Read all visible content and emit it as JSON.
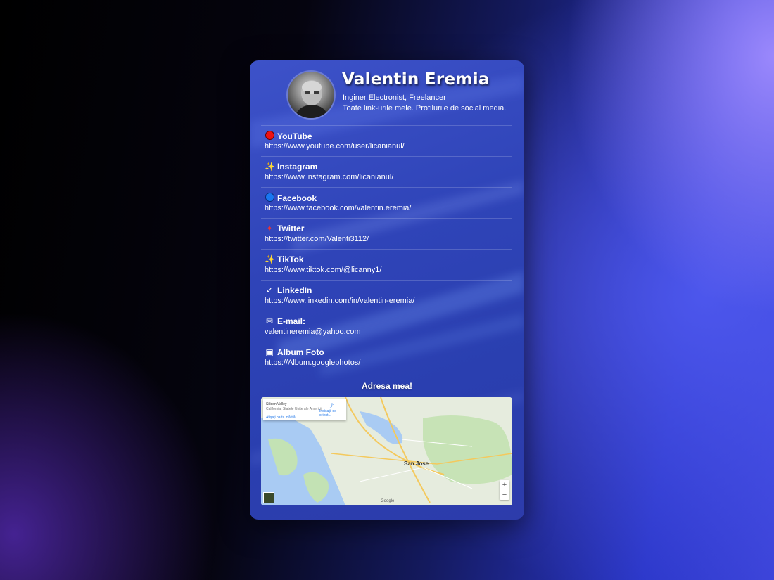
{
  "profile": {
    "name": "Valentin Eremia",
    "subtitle_1": "Inginer Electronist, Freelancer",
    "subtitle_2": "Toate link-urile mele. Profilurile de social media."
  },
  "links": [
    {
      "icon": "red-circle-icon",
      "title": "YouTube",
      "url": "https://www.youtube.com/user/licanianul/"
    },
    {
      "icon": "sparkles-icon",
      "title": "Instagram",
      "url": "https://www.instagram.com/licanianul/"
    },
    {
      "icon": "blue-circle-icon",
      "title": "Facebook",
      "url": "https://www.facebook.com/valentin.eremia/"
    },
    {
      "icon": "bird-icon",
      "title": "Twitter",
      "url": "https://twitter.com/Valenti3112/"
    },
    {
      "icon": "sparkles-icon",
      "title": "TikTok",
      "url": "https://www.tiktok.com/@licanny1/"
    },
    {
      "icon": "check-mark-icon",
      "title": "LinkedIn",
      "url": "https://www.linkedin.com/in/valentin-eremia/"
    },
    {
      "icon": "envelope-icon",
      "title": "E-mail:",
      "url": "valentineremia@yahoo.com"
    },
    {
      "icon": "camera-icon",
      "title": "Album Foto",
      "url": "https://Album.googlephotos/"
    }
  ],
  "address_title": "Adresa mea!",
  "map": {
    "place_name": "Silicon Valley",
    "place_detail": "California, Statele Unite ale Americii",
    "directions": "Indicații de orient...",
    "larger_map": "Afișați harta mărită",
    "city": "San Jose",
    "zoom_in": "+",
    "zoom_out": "−",
    "attribution": "Google",
    "colors": {
      "water": "#a9cbf3",
      "land": "#e8eee2",
      "park": "#bfe0b0",
      "road": "#ffe08a"
    }
  },
  "colors": {
    "card": "#2f44b8",
    "accent_red": "#e11",
    "accent_blue": "#1877f2"
  }
}
